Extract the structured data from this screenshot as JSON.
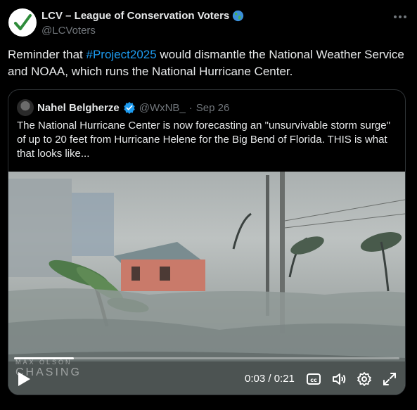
{
  "author": {
    "display_name": "LCV – League of Conservation Voters",
    "handle": "@LCVoters",
    "badge_icon": "globe-emoji-icon",
    "avatar_icon": "green-checkmark-icon"
  },
  "tweet": {
    "text_before": "Reminder that ",
    "hashtag": "#Project2025",
    "text_after": " would dismantle the National Weather Service and NOAA, which runs the National Hurricane Center."
  },
  "quote": {
    "name": "Nahel Belgherze",
    "handle": "@WxNB_",
    "separator": "·",
    "date": "Sep 26",
    "text": "The National Hurricane Center is now forecasting an \"unsurvivable storm surge\" of up to 20 feet from Hurricane Helene for the Big Bend of Florida. THIS is what that looks like..."
  },
  "video": {
    "time": "0:03 / 0:21",
    "progress": 0.155,
    "watermark_line1": "MAX OLSON",
    "watermark_line2": "CHASING"
  },
  "colors": {
    "background": "#000000",
    "text": "#e7e9ea",
    "muted": "#71767b",
    "link": "#1d9bf0",
    "verified": "#1d9bf0"
  }
}
